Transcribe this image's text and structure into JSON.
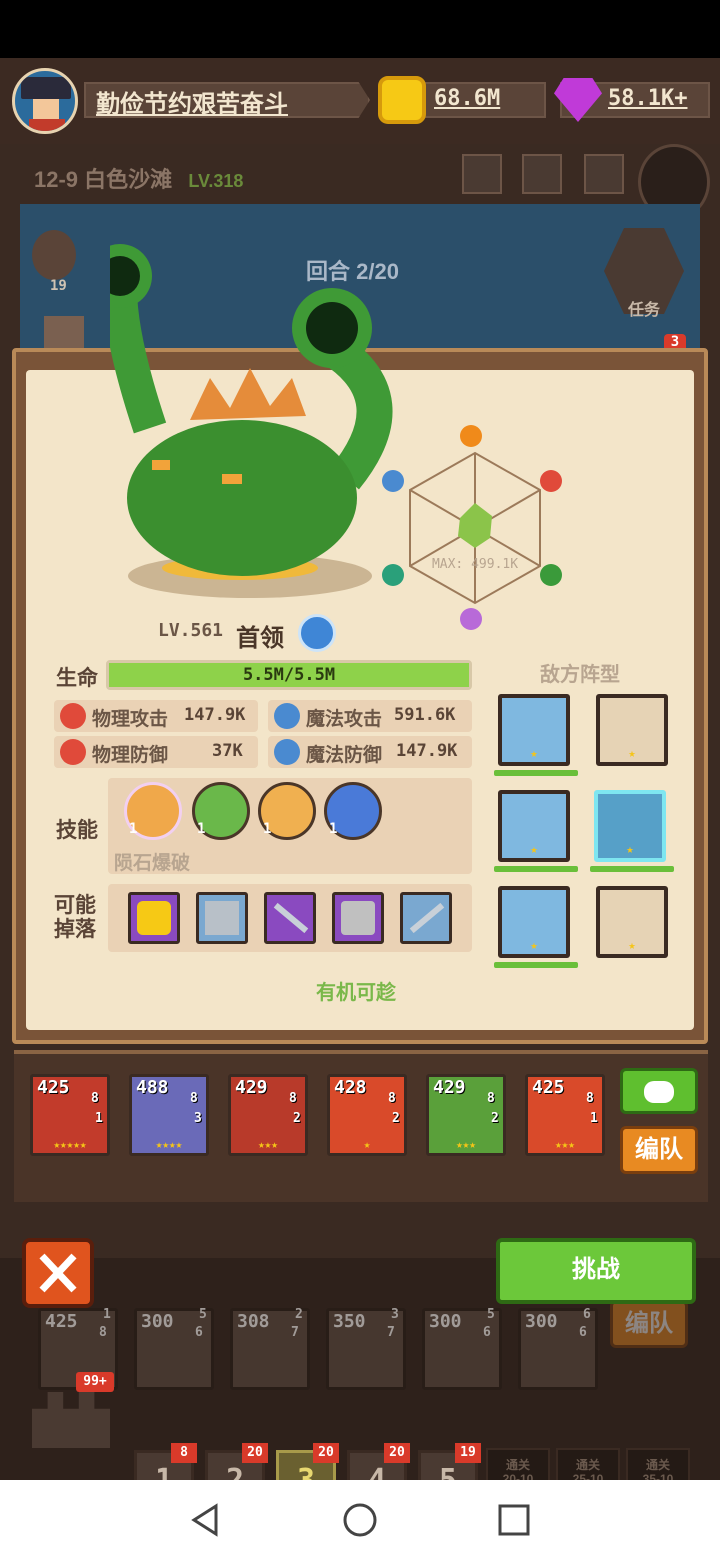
{
  "player": {
    "name": "勤俭节约艰苦奋斗",
    "coins": "68.6M",
    "gems": "58.1K+"
  },
  "stage": {
    "id": "12-9",
    "name": "白色沙滩",
    "level": "LV.318"
  },
  "sky": {
    "left_badge": "19",
    "round": "回合 2/20",
    "task_label": "任务",
    "task_badge": "3"
  },
  "boss": {
    "level": "LV.561",
    "tag": "首领",
    "hp": {
      "text": "5.5M/5.5M",
      "fraction": 1.0
    },
    "radar_max": "MAX: 499.1K"
  },
  "stats": {
    "hp_label": "生命",
    "phys_atk": {
      "label": "物理攻击",
      "value": "147.9K"
    },
    "mag_atk": {
      "label": "魔法攻击",
      "value": "591.6K"
    },
    "phys_def": {
      "label": "物理防御",
      "value": "37K"
    },
    "mag_def": {
      "label": "魔法防御",
      "value": "147.9K"
    }
  },
  "skills": {
    "label": "技能",
    "items": [
      "1",
      "1",
      "1",
      "1"
    ],
    "selected_name": "陨石爆破"
  },
  "drops": {
    "label_line1": "可能",
    "label_line2": "掉落",
    "items": [
      "coin-icon",
      "book-icon",
      "sword-icon",
      "armor-icon",
      "sword-icon"
    ]
  },
  "chance": "有机可趁",
  "formation": {
    "title": "敌方阵型"
  },
  "team": {
    "heroes": [
      {
        "lv": "425",
        "a": "8",
        "b": "1",
        "stars": "★★★★★",
        "color": "#c23b2b"
      },
      {
        "lv": "488",
        "a": "8",
        "b": "3",
        "stars": "★★★★",
        "color": "#6a6ab8"
      },
      {
        "lv": "429",
        "a": "8",
        "b": "2",
        "stars": "★★★",
        "color": "#b83a2a"
      },
      {
        "lv": "428",
        "a": "8",
        "b": "2",
        "stars": "★",
        "color": "#d94a2a"
      },
      {
        "lv": "429",
        "a": "8",
        "b": "2",
        "stars": "★★★",
        "color": "#5aa03a"
      },
      {
        "lv": "425",
        "a": "8",
        "b": "1",
        "stars": "★★★",
        "color": "#d94a2a"
      }
    ],
    "edit_label": "编队",
    "challenge_label": "挑战"
  },
  "lower_team": {
    "heroes": [
      {
        "lv": "425",
        "a": "8",
        "b": "1"
      },
      {
        "lv": "300",
        "a": "6",
        "b": "5"
      },
      {
        "lv": "308",
        "a": "7",
        "b": "2"
      },
      {
        "lv": "350",
        "a": "7",
        "b": "3"
      },
      {
        "lv": "300",
        "a": "6",
        "b": "5"
      },
      {
        "lv": "300",
        "a": "6",
        "b": "6"
      }
    ],
    "edit_label": "编队"
  },
  "castle_badge": "99+",
  "tabs": [
    {
      "n": "1",
      "b": "8"
    },
    {
      "n": "2",
      "b": "20"
    },
    {
      "n": "3",
      "b": "20"
    },
    {
      "n": "4",
      "b": "20"
    },
    {
      "n": "5",
      "b": "19"
    }
  ],
  "locked": [
    {
      "l1": "通关",
      "l2": "20-10",
      "l3": "解锁"
    },
    {
      "l1": "通关",
      "l2": "25-10",
      "l3": "解锁"
    },
    {
      "l1": "通关",
      "l2": "35-10",
      "l3": "解锁"
    }
  ]
}
